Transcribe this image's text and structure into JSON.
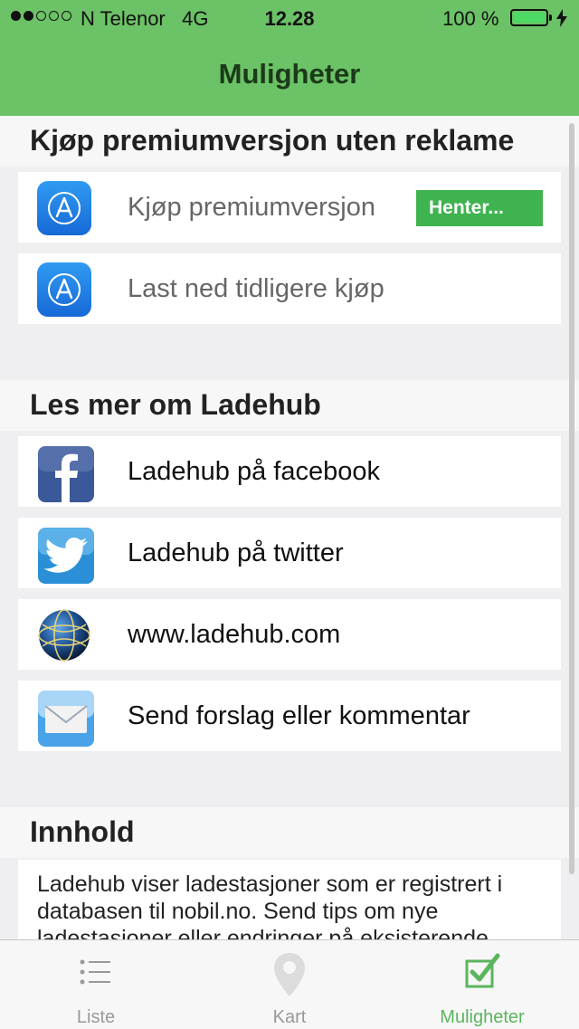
{
  "status_bar": {
    "carrier": "N Telenor",
    "network": "4G",
    "time": "12.28",
    "battery": "100 %",
    "battery_level": 1.0,
    "signal_bars": 2,
    "signal_total": 5
  },
  "nav": {
    "title": "Muligheter"
  },
  "sections": {
    "premium": {
      "header": "Kjøp premiumversjon uten reklame",
      "buy_label": "Kjøp premiumversjon",
      "buy_status": "Henter...",
      "restore_label": "Last ned tidligere kjøp",
      "icon": "app-store-icon"
    },
    "about": {
      "header": "Les mer om Ladehub",
      "items": [
        {
          "label": "Ladehub på facebook",
          "icon": "facebook-icon"
        },
        {
          "label": "Ladehub på twitter",
          "icon": "twitter-icon"
        },
        {
          "label": "www.ladehub.com",
          "icon": "globe-icon"
        },
        {
          "label": "Send forslag eller kommentar",
          "icon": "mail-icon"
        }
      ]
    },
    "content": {
      "header": "Innhold",
      "text": "Ladehub viser ladestasjoner som er registrert i databasen til nobil.no. Send tips om nye ladestasjoner eller endringer på eksisterende"
    }
  },
  "tabs": [
    {
      "label": "Liste",
      "icon": "list-icon",
      "active": false
    },
    {
      "label": "Kart",
      "icon": "map-pin-icon",
      "active": false
    },
    {
      "label": "Muligheter",
      "icon": "checkbox-icon",
      "active": true
    }
  ],
  "colors": {
    "nav_green": "#6cc266",
    "button_green": "#3fb34f",
    "active_tab": "#5bb55d"
  }
}
